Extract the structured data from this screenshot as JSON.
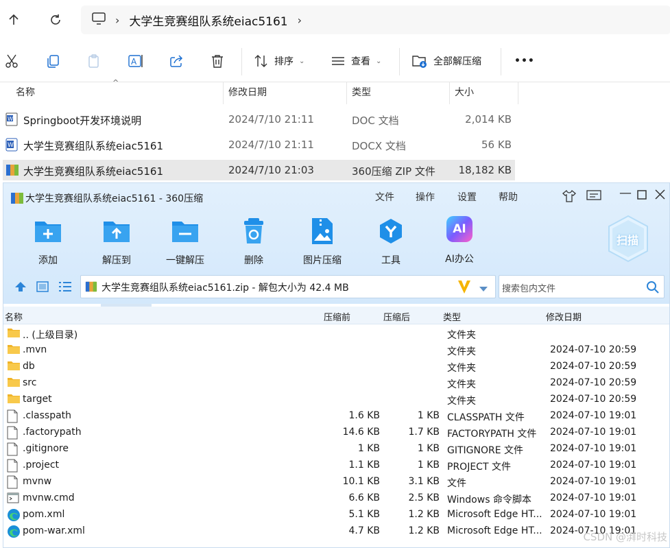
{
  "explorer": {
    "breadcrumb_title": "大学生竞赛组队系统eiac5161",
    "toolbar": {
      "sort_label": "排序",
      "view_label": "查看",
      "extract_all_label": "全部解压缩",
      "more_label": "•••"
    },
    "columns": {
      "name": "名称",
      "date": "修改日期",
      "type": "类型",
      "size": "大小"
    },
    "files": [
      {
        "name": "Springboot开发环境说明",
        "date": "2024/7/10 21:11",
        "type": "DOC 文档",
        "size": "2,014 KB",
        "icon": "word-doc-icon"
      },
      {
        "name": "大学生竞赛组队系统eiac5161",
        "date": "2024/7/10 21:11",
        "type": "DOCX 文档",
        "size": "56 KB",
        "icon": "word-docx-icon"
      },
      {
        "name": "大学生竞赛组队系统eiac5161",
        "date": "2024/7/10 21:03",
        "type": "360压缩 ZIP 文件",
        "size": "18,182 KB",
        "icon": "zip-archive-icon"
      }
    ]
  },
  "z360": {
    "title": "大学生竞赛组队系统eiac5161 - 360压缩",
    "menu": [
      "文件",
      "操作",
      "设置",
      "帮助"
    ],
    "tools": [
      {
        "label": "添加",
        "icon": "add-folder-icon"
      },
      {
        "label": "解压到",
        "icon": "extract-to-icon"
      },
      {
        "label": "一键解压",
        "icon": "one-click-extract-icon"
      },
      {
        "label": "删除",
        "icon": "delete-bin-icon"
      },
      {
        "label": "图片压缩",
        "icon": "image-compress-icon"
      },
      {
        "label": "工具",
        "icon": "tools-icon"
      },
      {
        "label": "AI办公",
        "icon": "ai-office-icon"
      }
    ],
    "scan_label": "扫描",
    "path": "大学生竞赛组队系统eiac5161.zip - 解包大小为 42.4 MB",
    "search_placeholder": "搜索包内文件",
    "columns": {
      "name": "名称",
      "before": "压缩前",
      "after": "压缩后",
      "type": "类型",
      "date": "修改日期"
    },
    "rows": [
      {
        "name": ".. (上级目录)",
        "before": "",
        "after": "",
        "type": "文件夹",
        "date": "",
        "icon": "folder-icon"
      },
      {
        "name": ".mvn",
        "before": "",
        "after": "",
        "type": "文件夹",
        "date": "2024-07-10 20:59",
        "icon": "folder-icon"
      },
      {
        "name": "db",
        "before": "",
        "after": "",
        "type": "文件夹",
        "date": "2024-07-10 20:59",
        "icon": "folder-icon"
      },
      {
        "name": "src",
        "before": "",
        "after": "",
        "type": "文件夹",
        "date": "2024-07-10 20:59",
        "icon": "folder-icon"
      },
      {
        "name": "target",
        "before": "",
        "after": "",
        "type": "文件夹",
        "date": "2024-07-10 20:59",
        "icon": "folder-icon"
      },
      {
        "name": ".classpath",
        "before": "1.6 KB",
        "after": "1 KB",
        "type": "CLASSPATH 文件",
        "date": "2024-07-10 19:01",
        "icon": "file-icon"
      },
      {
        "name": ".factorypath",
        "before": "14.6 KB",
        "after": "1.7 KB",
        "type": "FACTORYPATH 文件",
        "date": "2024-07-10 19:01",
        "icon": "file-icon"
      },
      {
        "name": ".gitignore",
        "before": "1 KB",
        "after": "1 KB",
        "type": "GITIGNORE 文件",
        "date": "2024-07-10 19:01",
        "icon": "file-icon"
      },
      {
        "name": ".project",
        "before": "1.1 KB",
        "after": "1 KB",
        "type": "PROJECT 文件",
        "date": "2024-07-10 19:01",
        "icon": "file-icon"
      },
      {
        "name": "mvnw",
        "before": "10.1 KB",
        "after": "3.1 KB",
        "type": "文件",
        "date": "2024-07-10 19:01",
        "icon": "file-icon"
      },
      {
        "name": "mvnw.cmd",
        "before": "6.6 KB",
        "after": "2.5 KB",
        "type": "Windows 命令脚本",
        "date": "2024-07-10 19:01",
        "icon": "cmd-script-icon"
      },
      {
        "name": "pom.xml",
        "before": "5.1 KB",
        "after": "1.2 KB",
        "type": "Microsoft Edge HT...",
        "date": "2024-07-10 19:01",
        "icon": "edge-icon"
      },
      {
        "name": "pom-war.xml",
        "before": "4.7 KB",
        "after": "1.2 KB",
        "type": "Microsoft Edge HT...",
        "date": "2024-07-10 19:01",
        "icon": "edge-icon"
      }
    ]
  },
  "watermark": "CSDN @湃时科技"
}
